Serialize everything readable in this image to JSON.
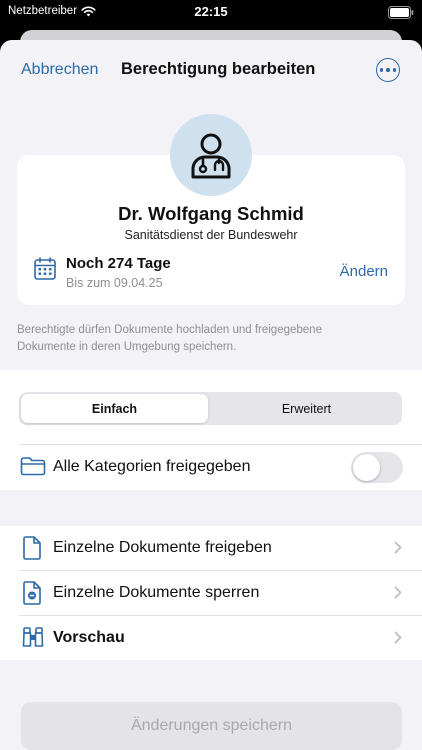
{
  "status_bar": {
    "carrier": "Netzbetreiber",
    "time": "22:15"
  },
  "nav": {
    "cancel_label": "Abbrechen",
    "title": "Berechtigung bearbeiten",
    "more_icon": "ellipsis-circle-icon"
  },
  "person": {
    "name": "Dr. Wolfgang Schmid",
    "organization": "Sanitätsdienst der Bundeswehr",
    "avatar_icon": "doctor-icon"
  },
  "validity": {
    "days_left": "Noch 274 Tage",
    "until": "Bis zum 09.04.25",
    "change_label": "Ändern",
    "icon": "calendar-icon"
  },
  "info_text": "Berechtigte dürfen Dokumente hochladen und freigegebene Dokumente in deren Umgebung speichern.",
  "segmented": {
    "options": [
      "Einfach",
      "Erweitert"
    ],
    "selected": "Einfach"
  },
  "categories_toggle": {
    "label": "Alle Kategorien freigegeben",
    "on": false,
    "icon": "folder-icon"
  },
  "list": [
    {
      "label": "Einzelne Dokumente freigeben",
      "icon": "document-icon",
      "bold": false
    },
    {
      "label": "Einzelne Dokumente sperren",
      "icon": "document-blocked-icon",
      "bold": false
    },
    {
      "label": "Vorschau",
      "icon": "binoculars-icon",
      "bold": true
    }
  ],
  "save_button": {
    "label": "Änderungen speichern",
    "enabled": false
  },
  "colors": {
    "accent": "#2c6aa8",
    "background": "#f2f2f7",
    "secondary_text": "#8e8e93",
    "avatar_bg": "#cfe0ee"
  }
}
